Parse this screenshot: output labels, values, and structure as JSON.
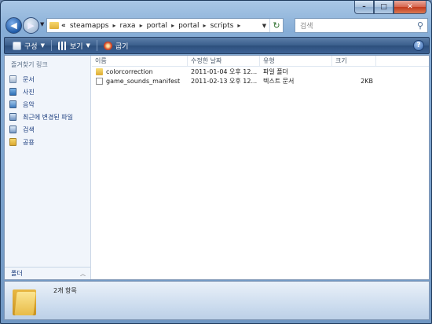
{
  "window": {
    "caption": {
      "minimize": "–",
      "maximize": "□",
      "close": "✕"
    }
  },
  "nav": {
    "back_icon": "◀",
    "forward_icon": "▶",
    "dropdown": "▼"
  },
  "address": {
    "prefix": "«",
    "crumbs": [
      "steamapps",
      "raxa",
      "portal",
      "portal",
      "scripts"
    ],
    "separator": "▸",
    "dropdown": "▼",
    "refresh": "↻"
  },
  "search": {
    "placeholder": "검색",
    "icon": "search-icon"
  },
  "command_bar": {
    "organize_label": "구성",
    "views_label": "보기",
    "burn_label": "굽기",
    "help_label": "?",
    "dropdown": "▼"
  },
  "nav_pane": {
    "header": "즐겨찾기 링크",
    "links": [
      {
        "label": "문서",
        "icon": "documents-icon"
      },
      {
        "label": "사진",
        "icon": "pictures-icon"
      },
      {
        "label": "음악",
        "icon": "music-icon"
      },
      {
        "label": "최근에 변경된 파일",
        "icon": "recent-icon"
      },
      {
        "label": "검색",
        "icon": "searches-icon"
      },
      {
        "label": "공용",
        "icon": "public-folder-icon"
      }
    ],
    "folders_label": "폴더",
    "folders_chevron": "︿"
  },
  "file_list": {
    "columns": [
      "이름",
      "수정한 날짜",
      "유형",
      "크기"
    ],
    "rows": [
      {
        "name": "colorcorrection",
        "date": "2011-01-04 오후 12...",
        "type": "파일 폴더",
        "size": "",
        "icon": "folder-icon"
      },
      {
        "name": "game_sounds_manifest",
        "date": "2011-02-13 오후 12...",
        "type": "텍스트 문서",
        "size": "2KB",
        "icon": "text-file-icon"
      }
    ]
  },
  "details": {
    "item_count": "2개 항목"
  },
  "colors": {
    "chrome": "#86add6",
    "command_bar": "#3a5e8c",
    "link_text": "#1c3d7e",
    "content_bg": "#ffffff"
  }
}
